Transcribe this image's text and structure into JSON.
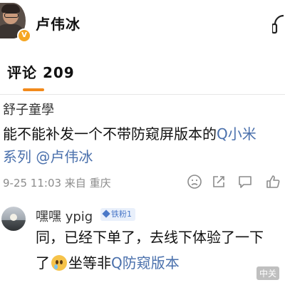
{
  "header": {
    "author_name": "卢伟冰"
  },
  "comments_tab": {
    "label": "评论 209"
  },
  "comment": {
    "user": "舒子童學",
    "text_line1_prefix": "能不能补发一个不带防窥屏版本的",
    "topic_prefix": "Q",
    "topic_text": "小米",
    "text_line2_series": "系列",
    "mention": "@卢伟冰",
    "meta": "9-25 11:03  来自 重庆"
  },
  "reply": {
    "user": "嘿嘿 ypig",
    "badge": "铁粉1",
    "line1": "同，已经下单了，去线下体验了一下",
    "line2_prefix": "了",
    "line2_mid": "坐等非",
    "topic_prefix": "Q",
    "topic_text": "防窥版本"
  },
  "watermark": "中关",
  "colors": {
    "accent": "#f28a1b",
    "link": "#4a70ac",
    "badge_bg": "#e9f0fb",
    "badge_fg": "#4a78c8"
  },
  "icons": [
    "verified-badge-icon",
    "listen-icon",
    "dislike-icon",
    "share-icon",
    "comment-icon",
    "like-icon",
    "emoji-cry-icon",
    "topic-search-icon"
  ]
}
